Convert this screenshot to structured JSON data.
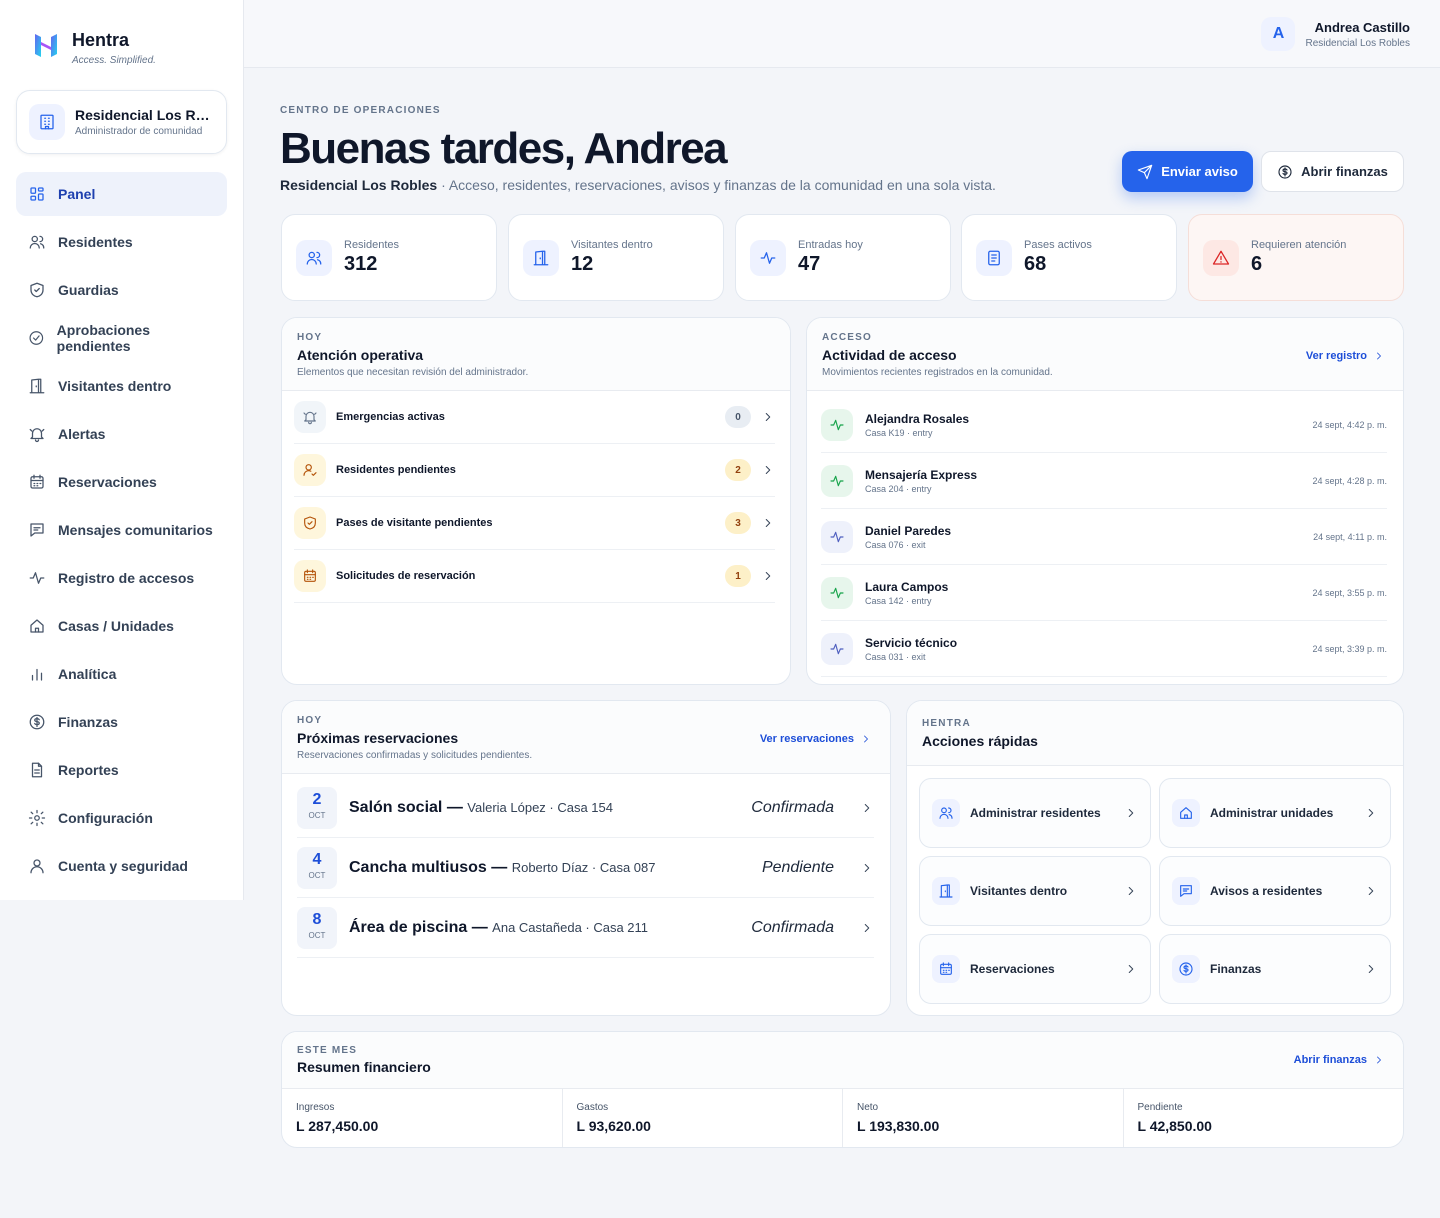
{
  "brand": {
    "name": "Hentra",
    "tagline": "Access. Simplified."
  },
  "community": {
    "name": "Residencial Los Robles",
    "role": "Administrador de comunidad"
  },
  "nav": [
    {
      "label": "Panel",
      "icon": "grid-icon",
      "active": true
    },
    {
      "label": "Residentes",
      "icon": "users-icon"
    },
    {
      "label": "Guardias",
      "icon": "shield-icon"
    },
    {
      "label": "Aprobaciones pendientes",
      "icon": "check-circle-icon"
    },
    {
      "label": "Visitantes dentro",
      "icon": "door-icon"
    },
    {
      "label": "Alertas",
      "icon": "bell-icon"
    },
    {
      "label": "Reservaciones",
      "icon": "calendar-icon"
    },
    {
      "label": "Mensajes comunitarios",
      "icon": "message-icon"
    },
    {
      "label": "Registro de accesos",
      "icon": "activity-icon"
    },
    {
      "label": "Casas / Unidades",
      "icon": "home-icon"
    },
    {
      "label": "Analítica",
      "icon": "bar-chart-icon"
    },
    {
      "label": "Finanzas",
      "icon": "dollar-icon"
    },
    {
      "label": "Reportes",
      "icon": "file-icon"
    },
    {
      "label": "Configuración",
      "icon": "gear-icon"
    },
    {
      "label": "Cuenta y seguridad",
      "icon": "user-icon"
    }
  ],
  "user": {
    "initial": "A",
    "name": "Andrea Castillo",
    "community": "Residencial Los Robles"
  },
  "hero": {
    "eyebrow": "CENTRO DE OPERACIONES",
    "title": "Buenas tardes, Andrea",
    "community": "Residencial Los Robles",
    "subtitle": "· Acceso, residentes, reservaciones, avisos y finanzas de la comunidad en una sola vista.",
    "primary_btn": "Enviar aviso",
    "secondary_btn": "Abrir finanzas"
  },
  "stats": [
    {
      "label": "Residentes",
      "value": "312",
      "icon": "users-icon"
    },
    {
      "label": "Visitantes dentro",
      "value": "12",
      "icon": "door-icon"
    },
    {
      "label": "Entradas hoy",
      "value": "47",
      "icon": "activity-icon"
    },
    {
      "label": "Pases activos",
      "value": "68",
      "icon": "pass-icon"
    },
    {
      "label": "Requieren atención",
      "value": "6",
      "icon": "warning-icon"
    }
  ],
  "attention": {
    "eyebrow": "HOY",
    "title": "Atención operativa",
    "desc": "Elementos que necesitan revisión del administrador.",
    "items": [
      {
        "label": "Emergencias activas",
        "count": "0",
        "icon": "bell-icon"
      },
      {
        "label": "Residentes pendientes",
        "count": "2",
        "icon": "user-check-icon"
      },
      {
        "label": "Pases de visitante pendientes",
        "count": "3",
        "icon": "shield-icon"
      },
      {
        "label": "Solicitudes de reservación",
        "count": "1",
        "icon": "calendar-icon"
      }
    ]
  },
  "activity": {
    "eyebrow": "ACCESO",
    "title": "Actividad de acceso",
    "desc": "Movimientos recientes registrados en la comunidad.",
    "link": "Ver registro",
    "items": [
      {
        "name": "Alejandra Rosales",
        "meta": "Casa K19 · entry",
        "time": "24 sept, 4:42 p. m.",
        "type": "entry"
      },
      {
        "name": "Mensajería Express",
        "meta": "Casa 204 · entry",
        "time": "24 sept, 4:28 p. m.",
        "type": "entry"
      },
      {
        "name": "Daniel Paredes",
        "meta": "Casa 076 · exit",
        "time": "24 sept, 4:11 p. m.",
        "type": "exit"
      },
      {
        "name": "Laura Campos",
        "meta": "Casa 142 · entry",
        "time": "24 sept, 3:55 p. m.",
        "type": "entry"
      },
      {
        "name": "Servicio técnico",
        "meta": "Casa 031 · exit",
        "time": "24 sept, 3:39 p. m.",
        "type": "exit"
      }
    ]
  },
  "reservations": {
    "eyebrow": "HOY",
    "title": "Próximas reservaciones",
    "desc": "Reservaciones confirmadas y solicitudes pendientes.",
    "link": "Ver reservaciones",
    "items": [
      {
        "day": "2",
        "month": "OCT",
        "place": "Salón social —",
        "who": "Valeria López · Casa 154",
        "status": "Confirmada"
      },
      {
        "day": "4",
        "month": "OCT",
        "place": "Cancha multiusos —",
        "who": "Roberto Díaz · Casa 087",
        "status": "Pendiente"
      },
      {
        "day": "8",
        "month": "OCT",
        "place": "Área de piscina —",
        "who": "Ana Castañeda · Casa 211",
        "status": "Confirmada"
      }
    ]
  },
  "quick": {
    "eyebrow": "HENTRA",
    "title": "Acciones rápidas",
    "items": [
      {
        "label": "Administrar residentes",
        "icon": "users-icon"
      },
      {
        "label": "Administrar unidades",
        "icon": "home-icon"
      },
      {
        "label": "Visitantes dentro",
        "icon": "door-icon"
      },
      {
        "label": "Avisos a residentes",
        "icon": "message-icon"
      },
      {
        "label": "Reservaciones",
        "icon": "calendar-icon"
      },
      {
        "label": "Finanzas",
        "icon": "dollar-icon"
      }
    ]
  },
  "finance": {
    "eyebrow": "ESTE MES",
    "title": "Resumen financiero",
    "link": "Abrir finanzas",
    "items": [
      {
        "label": "Ingresos",
        "value": "L 287,450.00"
      },
      {
        "label": "Gastos",
        "value": "L 93,620.00"
      },
      {
        "label": "Neto",
        "value": "L 193,830.00"
      },
      {
        "label": "Pendiente",
        "value": "L 42,850.00"
      }
    ]
  },
  "colors": {
    "accent": "#2563eb",
    "entry": "#16a34a",
    "exit": "#4f5fbf",
    "warning": "#dc2626",
    "amber": "#b45309"
  }
}
